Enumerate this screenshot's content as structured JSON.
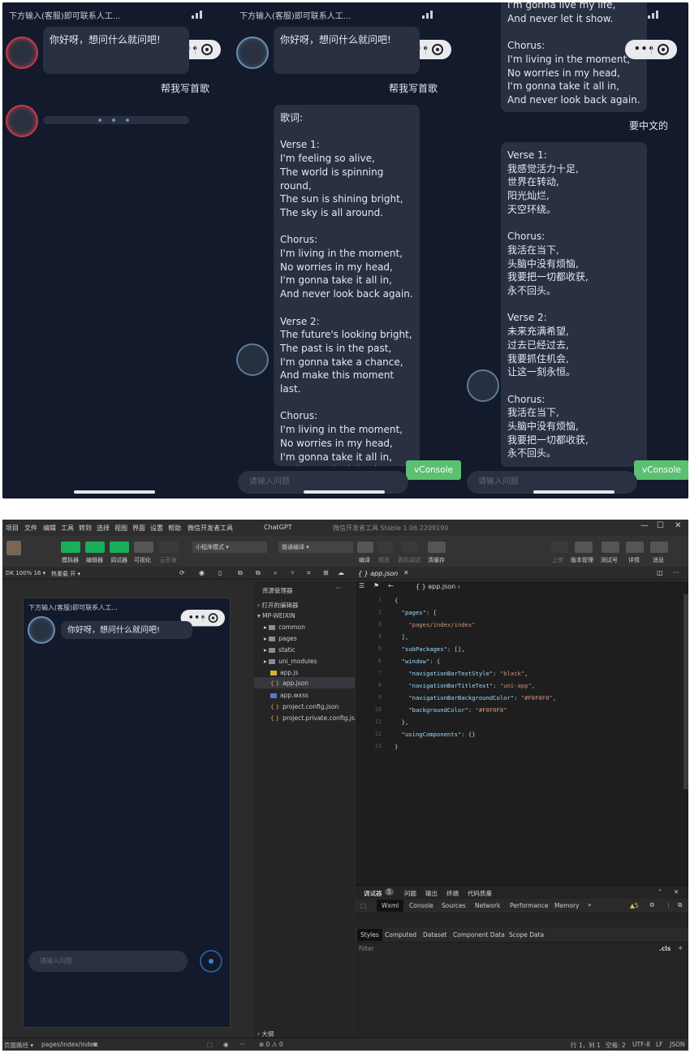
{
  "phone": {
    "status_text": "下方输入(客服)即可联系人工...",
    "greeting": "你好呀，想问什么就问吧!",
    "user_msg_1": "帮我写首歌",
    "user_msg_2": "要中文的",
    "vconsole": "vConsole",
    "input_placeholder": "请输入问题",
    "lyrics_en": "歌词:\n\nVerse 1:\nI'm feeling so alive,\nThe world is spinning round,\nThe sun is shining bright,\nThe sky is all around.\n\nChorus:\nI'm living in the moment,\nNo worries in my head,\nI'm gonna take it all in,\nAnd never look back again.\n\nVerse 2:\nThe future's looking bright,\nThe past is in the past,\nI'm gonna take a chance,\nAnd make this moment last.\n\nChorus:\nI'm living in the moment,\nNo worries in my head,\nI'm gonna take it all in,\nAnd never look back again.",
    "lyrics_en_tail": "I'm gonna live my life,\nAnd never let it show.\n\nChorus:\nI'm living in the moment,\nNo worries in my head,\nI'm gonna take it all in,\nAnd never look back again.",
    "lyrics_zh": "Verse 1:\n我感觉活力十足,\n世界在转动,\n阳光灿烂,\n天空环绕。\n\nChorus:\n我活在当下,\n头脑中没有烦恼,\n我要把一切都收获,\n永不回头。\n\nVerse 2:\n未来充满希望,\n过去已经过去,\n我要抓住机会,\n让这一刻永恒。\n\nChorus:\n我活在当下,\n头脑中没有烦恼,\n我要把一切都收获,\n永不回头。"
  },
  "ide": {
    "menu": [
      "项目",
      "文件",
      "编辑",
      "工具",
      "转到",
      "选择",
      "视图",
      "界面",
      "设置",
      "帮助",
      "微信开发者工具"
    ],
    "window_title": "ChatGPT",
    "app_version": "微信开发者工具 Stable 1.06.2209190",
    "toolbar_left": [
      "模拟器",
      "编辑器",
      "调试器",
      "可视化",
      "云开发"
    ],
    "mode_select": "小程序模式",
    "compile_select": "普通编译",
    "toolbar_mid": [
      "编译",
      "预览",
      "真机调试",
      "清缓存"
    ],
    "toolbar_right": [
      "上传",
      "版本管理",
      "测试号",
      "详情",
      "消息"
    ],
    "device": "DK 100% 16 ▾",
    "hot_reload": "热重载 开 ▾",
    "explorer_title": "资源管理器",
    "explorer_items": [
      {
        "label": "› 打开的编辑器",
        "level": 0,
        "kind": "section"
      },
      {
        "label": "▾ MP-WEIXIN",
        "level": 0,
        "kind": "section"
      },
      {
        "label": "common",
        "level": 1,
        "kind": "folder"
      },
      {
        "label": "pages",
        "level": 1,
        "kind": "folder"
      },
      {
        "label": "static",
        "level": 1,
        "kind": "folder"
      },
      {
        "label": "uni_modules",
        "level": 1,
        "kind": "folder"
      },
      {
        "label": "app.js",
        "level": 2,
        "kind": "js"
      },
      {
        "label": "app.json",
        "level": 2,
        "kind": "json"
      },
      {
        "label": "app.wxss",
        "level": 2,
        "kind": "wxss"
      },
      {
        "label": "project.config.json",
        "level": 2,
        "kind": "json"
      },
      {
        "label": "project.private.config.js...",
        "level": 2,
        "kind": "json"
      }
    ],
    "outline": "› 大纲",
    "tab_name": "{ } app.json",
    "breadcrumb": "{ } app.json ›",
    "code_lines": [
      "{",
      "  \"pages\": [",
      "    \"pages/index/index\"",
      "  ],",
      "  \"subPackages\": [],",
      "  \"window\": {",
      "    \"navigationBarTextStyle\": \"black\",",
      "    \"navigationBarTitleText\": \"uni-app\",",
      "    \"navigationBarBackgroundColor\": \"#F8F8F8\",",
      "    \"backgroundColor\": \"#F8F8F8\"",
      "  },",
      "  \"usingComponents\": {}",
      "}"
    ],
    "dev_tabs_top": [
      "调试器",
      "5",
      "问题",
      "输出",
      "终端",
      "代码质量"
    ],
    "dev_tabs": [
      "Wxml",
      "Console",
      "Sources",
      "Network",
      "Performance",
      "Memory",
      "»"
    ],
    "warnings": "▲5",
    "style_tabs": [
      "Styles",
      "Computed",
      "Dataset",
      "Component Data",
      "Scope Data"
    ],
    "filter": "Filter",
    "cls": ".cls",
    "status_left": [
      "页面路径 ▾",
      "pages/index/index"
    ],
    "status_errors": "⊗ 0 ⚠ 0",
    "status_right": [
      "行 1，列 1",
      "空格: 2",
      "UTF-8",
      "LF",
      "JSON"
    ]
  }
}
